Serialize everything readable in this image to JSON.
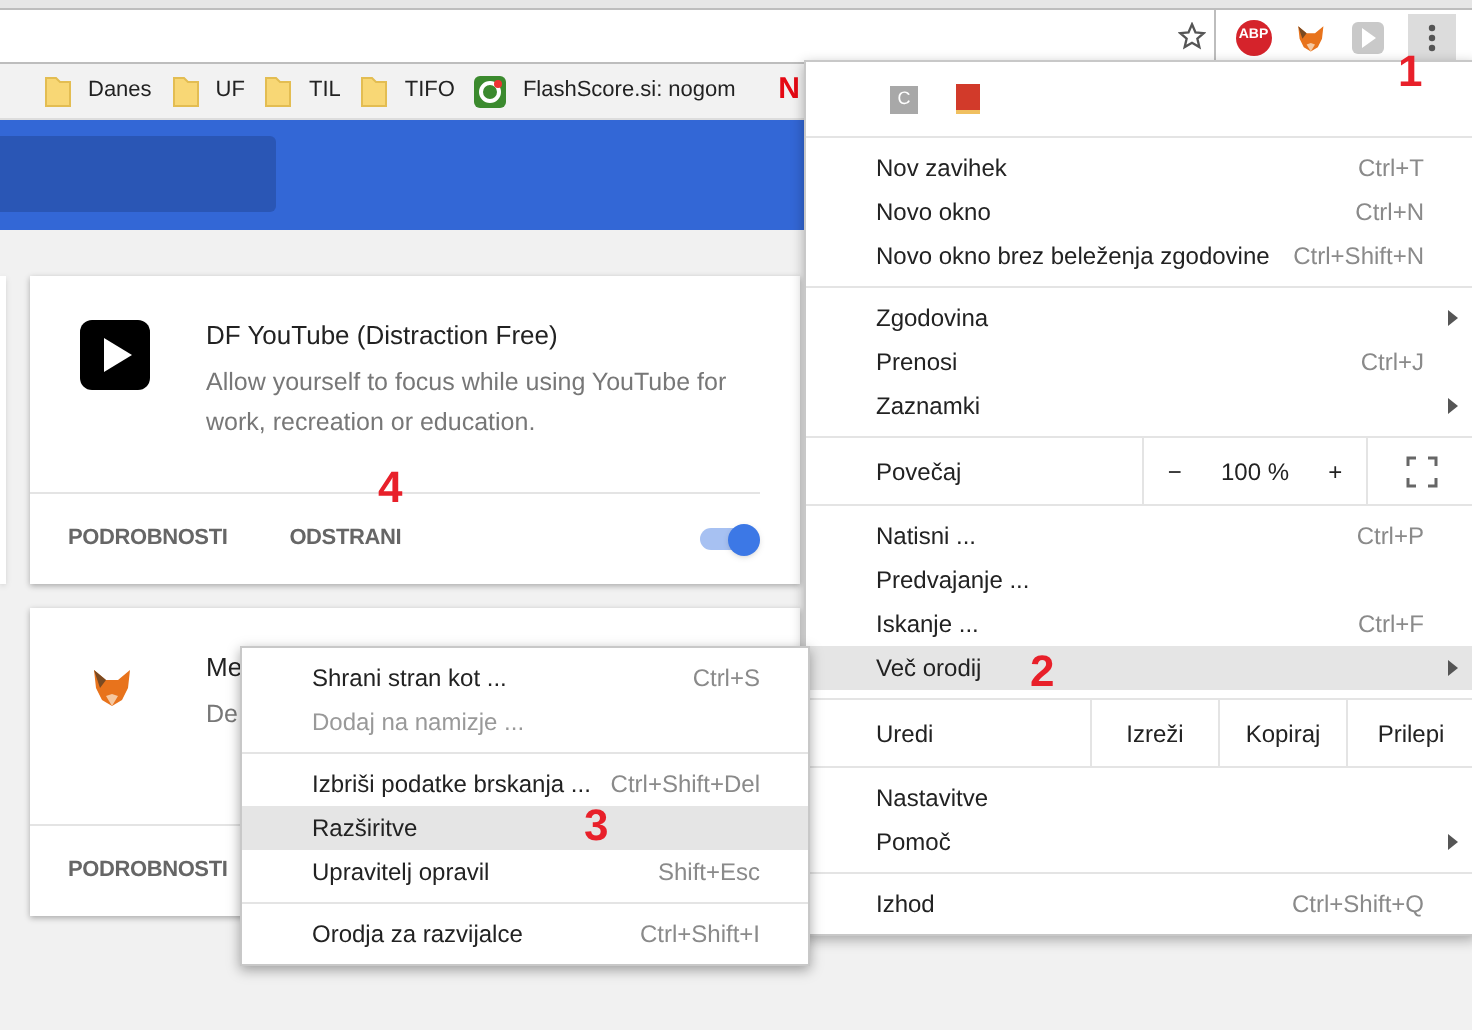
{
  "toolbar": {
    "extensions": [
      {
        "kind": "abp",
        "label": "ABP"
      },
      {
        "kind": "fox"
      },
      {
        "kind": "play"
      }
    ],
    "menu_open": true
  },
  "bookmarks": [
    {
      "kind": "folder",
      "label": "Danes"
    },
    {
      "kind": "folder",
      "label": "UF"
    },
    {
      "kind": "folder",
      "label": "TIL"
    },
    {
      "kind": "folder",
      "label": "TIFO"
    },
    {
      "kind": "site",
      "label": "FlashScore.si: nogom"
    },
    {
      "kind": "netflix",
      "label": "N"
    }
  ],
  "extensions": [
    {
      "kind": "play",
      "name": "DF YouTube (Distraction Free)",
      "description": "Allow yourself to focus while using YouTube for work, recreation or education.",
      "buttons": [
        "PODROBNOSTI",
        "ODSTRANI"
      ],
      "enabled": true
    },
    {
      "kind": "fox",
      "name": "Me",
      "description": "De",
      "buttons": [
        "PODROBNOSTI"
      ]
    }
  ],
  "chrome_menu": {
    "icons": [
      {
        "kind": "letter",
        "label": "C"
      },
      {
        "kind": "book"
      }
    ],
    "sections": [
      [
        {
          "kind": "item",
          "label": "Nov zavihek",
          "shortcut": "Ctrl+T",
          "submenu": false,
          "selected": false
        },
        {
          "kind": "item",
          "label": "Novo okno",
          "shortcut": "Ctrl+N",
          "submenu": false,
          "selected": false
        },
        {
          "kind": "item",
          "label": "Novo okno brez beleženja zgodovine",
          "shortcut": "Ctrl+Shift+N",
          "submenu": false,
          "selected": false
        }
      ],
      [
        {
          "kind": "item",
          "label": "Zgodovina",
          "submenu": true,
          "selected": false
        },
        {
          "kind": "item",
          "label": "Prenosi",
          "shortcut": "Ctrl+J",
          "submenu": false,
          "selected": false
        },
        {
          "kind": "item",
          "label": "Zaznamki",
          "submenu": true,
          "selected": false
        }
      ],
      [
        {
          "kind": "zoom",
          "label": "Povečaj",
          "minus": "−",
          "value": "100 %",
          "plus": "+"
        }
      ],
      [
        {
          "kind": "item",
          "label": "Natisni ...",
          "shortcut": "Ctrl+P",
          "submenu": false,
          "selected": false
        },
        {
          "kind": "item",
          "label": "Predvajanje ...",
          "submenu": false,
          "selected": false
        },
        {
          "kind": "item",
          "label": "Iskanje ...",
          "shortcut": "Ctrl+F",
          "submenu": false,
          "selected": false
        },
        {
          "kind": "item",
          "label": "Več orodij",
          "submenu": true,
          "selected": true
        }
      ],
      [
        {
          "kind": "edit",
          "label": "Uredi",
          "actions": [
            "Izreži",
            "Kopiraj",
            "Prilepi"
          ]
        }
      ],
      [
        {
          "kind": "item",
          "label": "Nastavitve",
          "submenu": false,
          "selected": false
        },
        {
          "kind": "item",
          "label": "Pomoč",
          "submenu": true,
          "selected": false
        }
      ],
      [
        {
          "kind": "item",
          "label": "Izhod",
          "shortcut": "Ctrl+Shift+Q",
          "submenu": false,
          "selected": false
        }
      ]
    ]
  },
  "submenu": {
    "sections": [
      [
        {
          "label": "Shrani stran kot ...",
          "shortcut": "Ctrl+S",
          "disabled": false,
          "selected": false
        },
        {
          "label": "Dodaj na namizje ...",
          "disabled": true,
          "selected": false
        }
      ],
      [
        {
          "label": "Izbriši podatke brskanja ...",
          "shortcut": "Ctrl+Shift+Del",
          "disabled": false,
          "selected": false
        },
        {
          "label": "Razširitve",
          "disabled": false,
          "selected": true
        },
        {
          "label": "Upravitelj opravil",
          "shortcut": "Shift+Esc",
          "disabled": false,
          "selected": false
        }
      ],
      [
        {
          "label": "Orodja za razvijalce",
          "shortcut": "Ctrl+Shift+I",
          "disabled": false,
          "selected": false
        }
      ]
    ]
  },
  "annotations": [
    "1",
    "2",
    "3",
    "4"
  ]
}
